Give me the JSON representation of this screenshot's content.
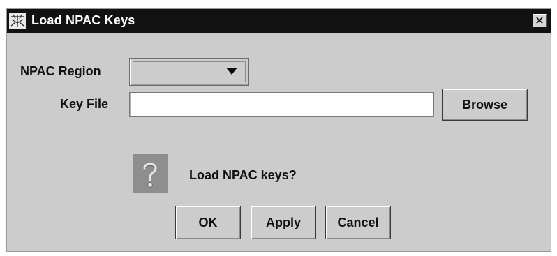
{
  "window": {
    "title": "Load NPAC Keys",
    "close_symbol": "✕"
  },
  "form": {
    "npac_region_label": "NPAC Region",
    "npac_region_value": "",
    "key_file_label": "Key File",
    "key_file_value": "",
    "browse_label": "Browse"
  },
  "message": {
    "icon": "question-icon",
    "text": "Load NPAC keys?"
  },
  "buttons": {
    "ok_label": "OK",
    "apply_label": "Apply",
    "cancel_label": "Cancel"
  }
}
